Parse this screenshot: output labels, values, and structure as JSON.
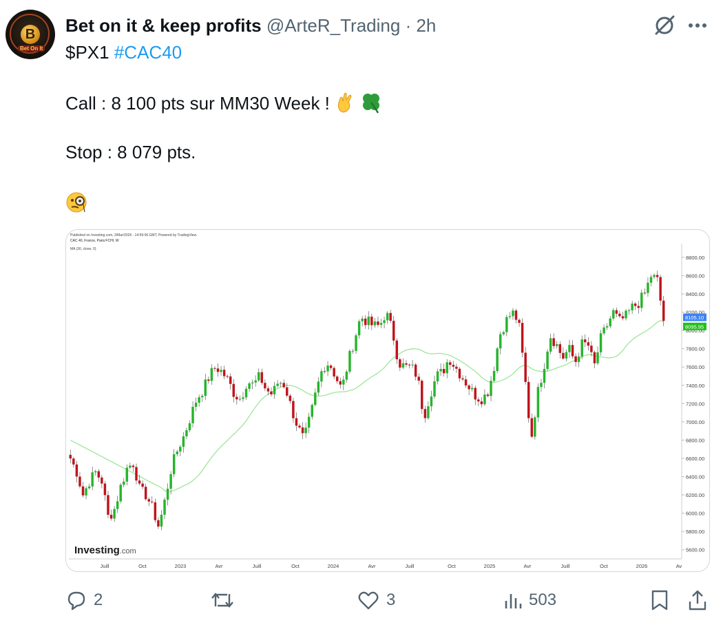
{
  "post": {
    "display_name": "Bet on it & keep profits",
    "handle": "@ArteR_Trading",
    "separator": "·",
    "time": "2h",
    "lines": {
      "ticker": "$PX1",
      "hashtag": "#CAC40",
      "call": "Call : 8 100 pts sur MM30 Week !",
      "stop": "Stop : 8 079 pts."
    },
    "emojis": [
      "crossed-fingers",
      "four-leaf-clover",
      "face-with-monocle"
    ]
  },
  "avatar": {
    "letter": "B",
    "tag": "Bet On It"
  },
  "chart": {
    "published": "Published on Investing.com, 3/Mar/2026 - 14:59:06 GMT, Powered by TradingView.",
    "symbol": "CAC 40, France, Paris:FCHI, W",
    "indicator": "MA (30, close, 0)",
    "watermark_main": "Investing",
    "watermark_suffix": ".com",
    "last_price_label": "8105.10",
    "ma_label": "8095.95",
    "colors": {
      "up": "#26b52c",
      "down": "#c0141c",
      "ma": "#9ee69a",
      "price_tag": "#3b82f6",
      "ma_tag": "#22c01c"
    }
  },
  "chart_data": {
    "type": "candlestick",
    "title": "CAC 40, France, Paris:FCHI, W",
    "indicator": "MA (30, close, 0)",
    "y_ticks": [
      5600,
      5800,
      6000,
      6200,
      6400,
      6600,
      6800,
      7000,
      7200,
      7400,
      7600,
      7800,
      8000,
      8200,
      8400,
      8600,
      8800
    ],
    "y_tick_labels": [
      "5600.00",
      "5800.00",
      "6000.00",
      "6200.00",
      "6400.00",
      "6600.00",
      "6800.00",
      "7000.00",
      "7200.00",
      "7400.00",
      "7600.00",
      "7800.00",
      "8000.00",
      "8200.00",
      "8400.00",
      "8600.00",
      "8800.00"
    ],
    "ylim": [
      5500,
      8950
    ],
    "x_labels": [
      "Juill",
      "Oct",
      "2023",
      "Avr",
      "Juill",
      "Oct",
      "2024",
      "Avr",
      "Juill",
      "Oct",
      "2025",
      "Avr",
      "Juill",
      "Oct",
      "2026",
      "Av"
    ],
    "last_close": 8105.1,
    "ma_last": 8095.95,
    "close_path": [
      6600,
      6450,
      6200,
      6350,
      6450,
      6350,
      5950,
      6050,
      6300,
      6500,
      6550,
      6250,
      6200,
      6050,
      5850,
      6150,
      6500,
      6700,
      6850,
      7050,
      7250,
      7350,
      7500,
      7600,
      7550,
      7450,
      7300,
      7250,
      7450,
      7400,
      7500,
      7350,
      7300,
      7450,
      7400,
      7150,
      6950,
      6800,
      7050,
      7350,
      7600,
      7650,
      7500,
      7350,
      7650,
      7900,
      8150,
      8100,
      8050,
      8050,
      8200,
      8000,
      7650,
      7600,
      7600,
      7500,
      7050,
      7300,
      7500,
      7550,
      7700,
      7600,
      7500,
      7400,
      7300,
      7250,
      7300,
      7550,
      7950,
      8100,
      8200,
      8100,
      7500,
      6800,
      7300,
      7600,
      7950,
      7850,
      7700,
      7800,
      7650,
      7850,
      7850,
      7600,
      7900,
      8050,
      8200,
      8100,
      8150,
      8250,
      8300,
      8400,
      8600,
      8550,
      8105
    ]
  },
  "actions": {
    "replies": "2",
    "reposts": "",
    "likes": "3",
    "views": "503"
  }
}
